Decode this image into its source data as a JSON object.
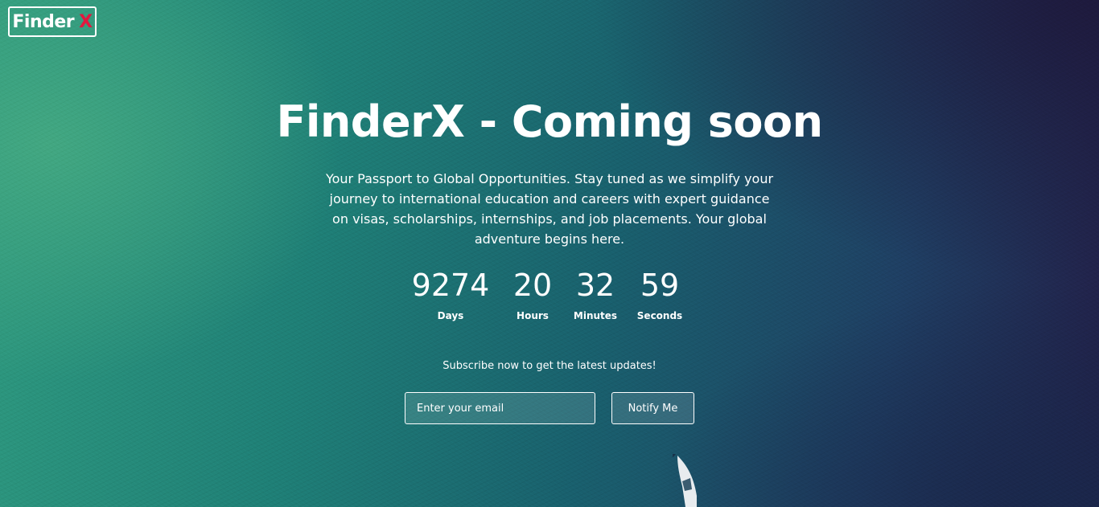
{
  "logo": {
    "text": "Finder",
    "mark": "X",
    "mark_color": "#e3173e"
  },
  "hero": {
    "title": "FinderX - Coming soon",
    "tagline": "Your Passport to Global Opportunities. Stay tuned as we simplify your journey to international education and careers with expert guidance on visas, scholarships, internships, and job placements. Your global adventure begins here."
  },
  "countdown": [
    {
      "value": "9274",
      "label": "Days"
    },
    {
      "value": "20",
      "label": "Hours"
    },
    {
      "value": "32",
      "label": "Minutes"
    },
    {
      "value": "59",
      "label": "Seconds"
    }
  ],
  "subscribe": {
    "text": "Subscribe now to get the latest updates!",
    "email_placeholder": "Enter your email",
    "button_label": "Notify Me"
  },
  "background": {
    "description_icon": "ocean-boat-icon"
  }
}
